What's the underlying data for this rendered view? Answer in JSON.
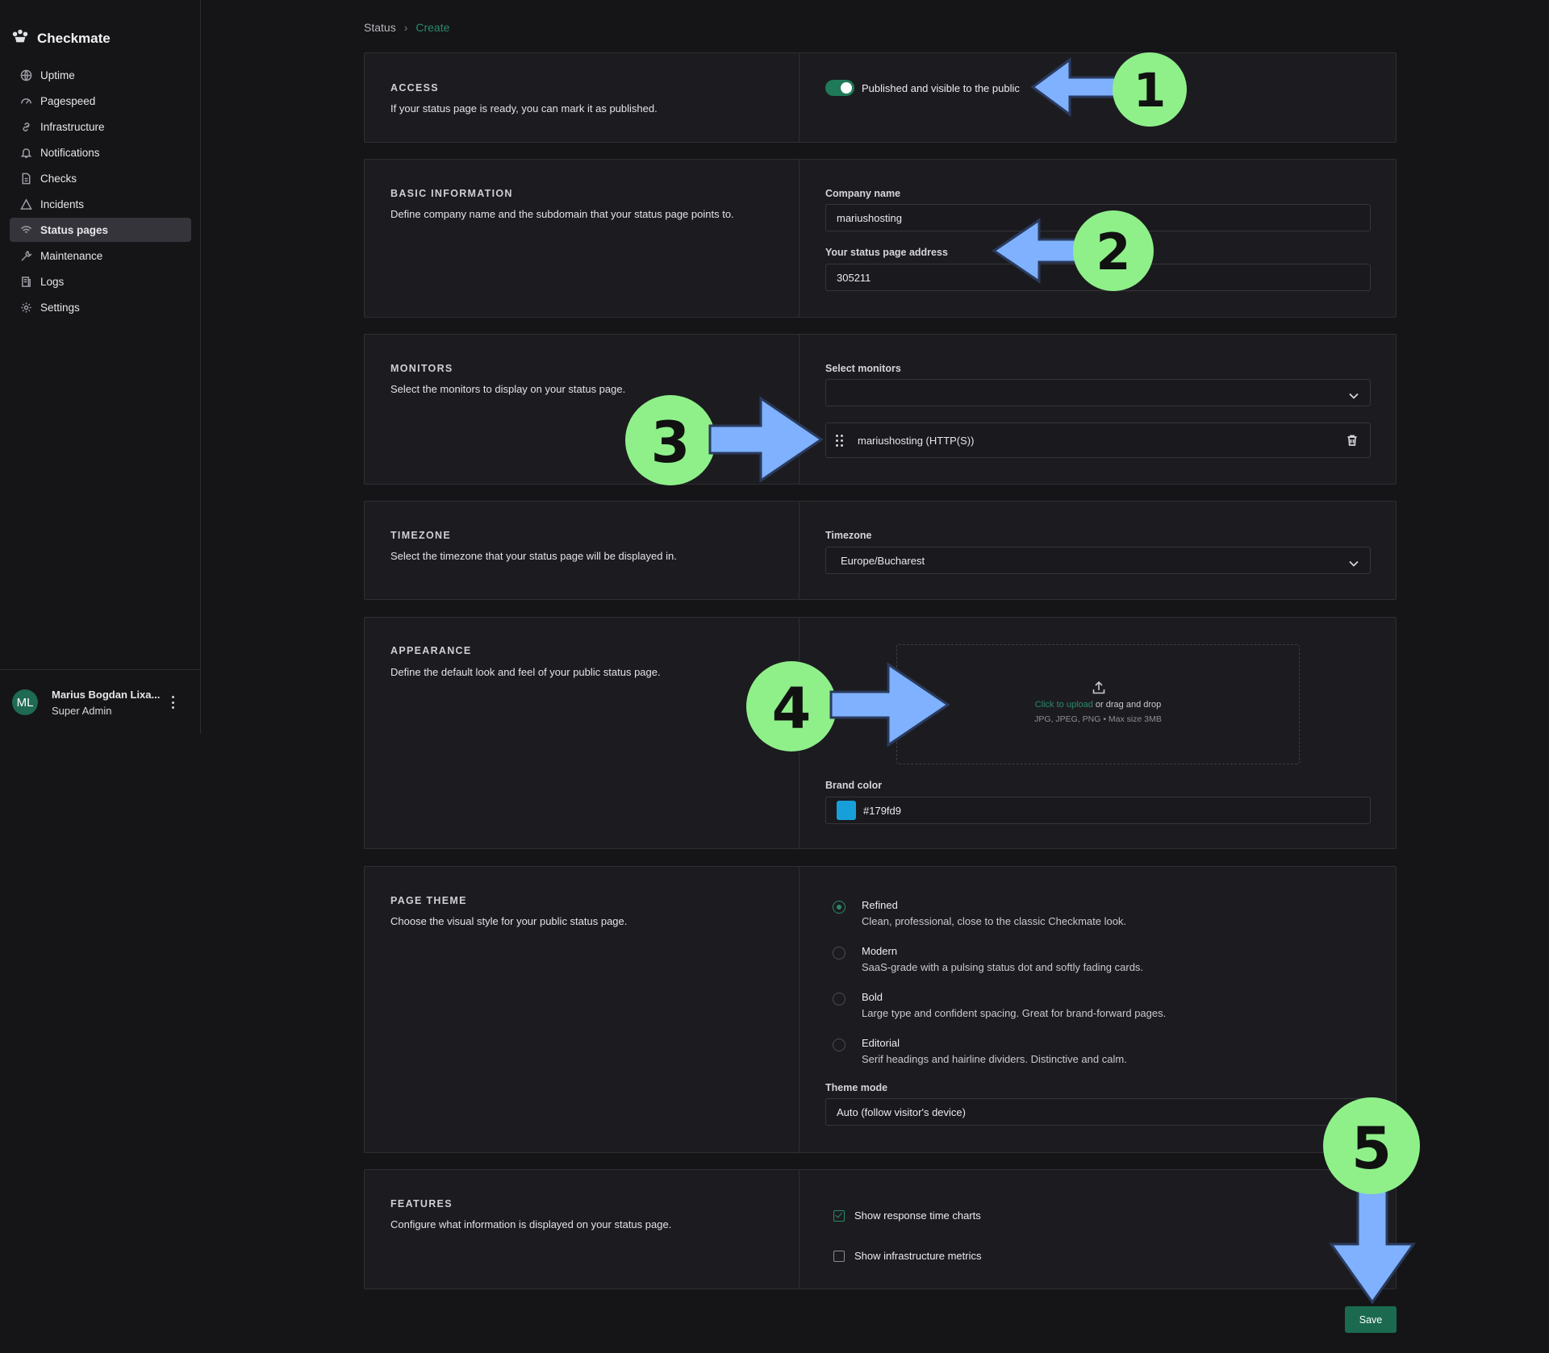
{
  "app": {
    "name": "Checkmate"
  },
  "sidebar": {
    "items": [
      {
        "label": "Uptime",
        "icon": "globe-icon"
      },
      {
        "label": "Pagespeed",
        "icon": "gauge-icon"
      },
      {
        "label": "Infrastructure",
        "icon": "link-icon"
      },
      {
        "label": "Notifications",
        "icon": "bell-icon"
      },
      {
        "label": "Checks",
        "icon": "document-icon"
      },
      {
        "label": "Incidents",
        "icon": "warning-icon"
      },
      {
        "label": "Status pages",
        "icon": "wifi-icon",
        "active": true
      },
      {
        "label": "Maintenance",
        "icon": "wrench-icon"
      },
      {
        "label": "Logs",
        "icon": "logs-icon"
      },
      {
        "label": "Settings",
        "icon": "gear-icon"
      }
    ],
    "user": {
      "initials": "ML",
      "name": "Marius Bogdan Lixa...",
      "role": "Super Admin"
    }
  },
  "breadcrumb": {
    "parent": "Status",
    "current": "Create"
  },
  "sections": {
    "access": {
      "title": "ACCESS",
      "description": "If your status page is ready, you can mark it as published.",
      "toggle_label": "Published and visible to the public",
      "published": true
    },
    "basic": {
      "title": "BASIC INFORMATION",
      "description": "Define company name and the subdomain that your status page points to.",
      "company_label": "Company name",
      "company_value": "mariushosting",
      "address_label": "Your status page address",
      "address_value": "305211"
    },
    "monitors": {
      "title": "MONITORS",
      "description": "Select the monitors to display on your status page.",
      "select_label": "Select monitors",
      "select_value": "",
      "selected": [
        "mariushosting (HTTP(S))"
      ]
    },
    "timezone": {
      "title": "TIMEZONE",
      "description": "Select the timezone that your status page will be displayed in.",
      "label": "Timezone",
      "value": "Europe/Bucharest"
    },
    "appearance": {
      "title": "APPEARANCE",
      "description": "Define the default look and feel of your public status page.",
      "upload_link": "Click to upload",
      "upload_text": " or drag and drop",
      "upload_hint": "JPG, JPEG, PNG • Max size 3MB",
      "brand_label": "Brand color",
      "brand_value": "#179fd9",
      "brand_color": "#179fd9"
    },
    "theme": {
      "title": "PAGE THEME",
      "description": "Choose the visual style for your public status page.",
      "options": [
        {
          "title": "Refined",
          "desc": "Clean, professional, close to the classic Checkmate look.",
          "checked": true
        },
        {
          "title": "Modern",
          "desc": "SaaS-grade with a pulsing status dot and softly fading cards.",
          "checked": false
        },
        {
          "title": "Bold",
          "desc": "Large type and confident spacing. Great for brand-forward pages.",
          "checked": false
        },
        {
          "title": "Editorial",
          "desc": "Serif headings and hairline dividers. Distinctive and calm.",
          "checked": false
        }
      ],
      "mode_label": "Theme mode",
      "mode_value": "Auto (follow visitor's device)"
    },
    "features": {
      "title": "FEATURES",
      "description": "Configure what information is displayed on your status page.",
      "options": [
        {
          "label": "Show response time charts",
          "checked": true
        },
        {
          "label": "Show infrastructure metrics",
          "checked": false
        }
      ]
    }
  },
  "actions": {
    "save_label": "Save"
  },
  "annotations": {
    "badges": [
      "1",
      "2",
      "3",
      "4",
      "5"
    ],
    "badge_color": "#8ff08a",
    "arrow_color": "#7fb1ff"
  }
}
